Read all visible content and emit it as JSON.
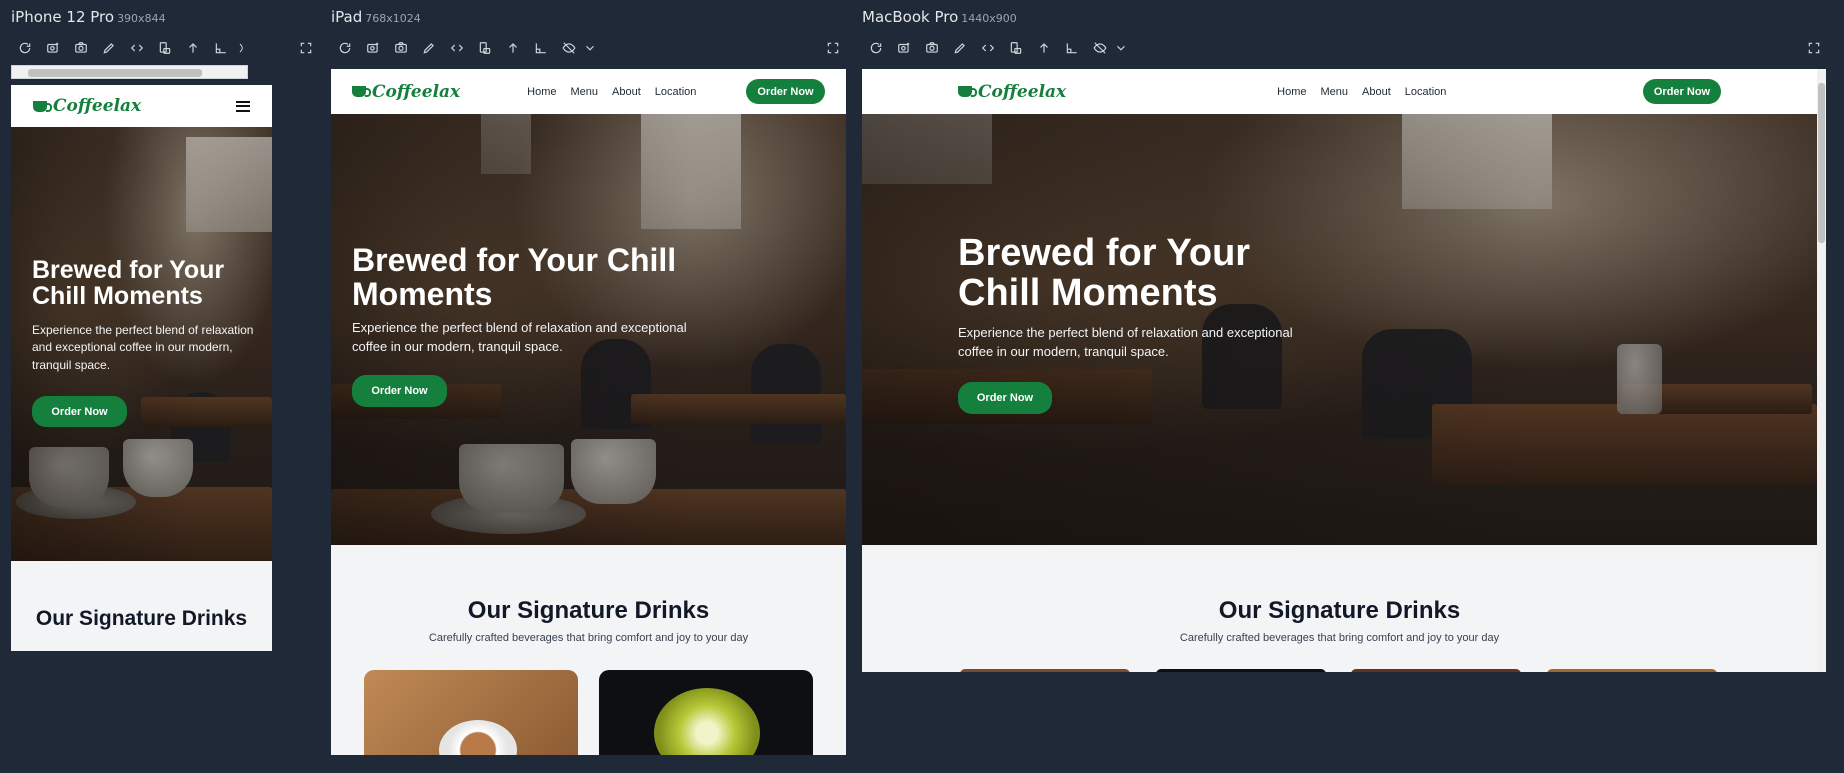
{
  "site": {
    "brand": "Coffeelax",
    "nav_links": [
      "Home",
      "Menu",
      "About",
      "Location"
    ],
    "order_button": "Order Now",
    "hero_title": "Brewed for Your Chill Moments",
    "hero_subtitle": "Experience the perfect blend of relaxation and exceptional coffee in our modern, tranquil space.",
    "hero_button": "Order Now",
    "section_title": "Our Signature Drinks",
    "section_subtitle": "Carefully crafted beverages that bring comfort and joy to your day",
    "accent_color": "#15803d"
  },
  "devices": [
    {
      "name": "iPhone 12 Pro",
      "resolution": "390x844"
    },
    {
      "name": "iPad",
      "resolution": "768x1024"
    },
    {
      "name": "MacBook Pro",
      "resolution": "1440x900"
    }
  ],
  "toolbar_icons": [
    "refresh-icon",
    "camera-plus-icon",
    "screenshot-icon",
    "pen-icon",
    "code-icon",
    "rotate-device-icon",
    "arrow-up-icon",
    "ruler-icon",
    "eye-off-icon",
    "chevron-down-icon"
  ],
  "expand_icon": "fullscreen-icon"
}
